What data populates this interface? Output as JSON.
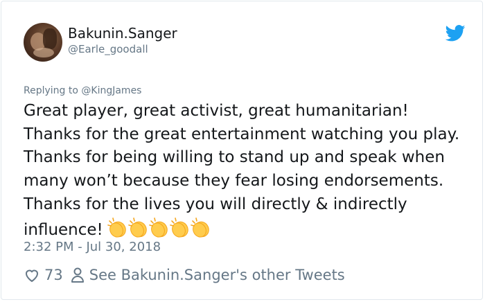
{
  "author": {
    "name": "Bakunin.Sanger",
    "handle": "@Earle_goodall"
  },
  "reply": {
    "prefix": "Replying to",
    "mention": "@KingJames"
  },
  "tweet": {
    "text": "Great player, great activist, great humanitarian! Thanks for the great entertainment watching you play. Thanks for being willing to stand up and speak when many won’t because they fear losing endorsements. Thanks for the lives you will directly & indirectly influence!",
    "emoji": "clapping-hands-emoji",
    "emoji_count": 5,
    "timestamp": "2:32 PM - Jul 30, 2018"
  },
  "actions": {
    "likes": "73",
    "other_tweets_label": "See Bakunin.Sanger's other Tweets"
  },
  "icons": {
    "brand": "twitter-bird-icon",
    "like": "heart-icon",
    "profile": "person-icon"
  },
  "colors": {
    "brand_blue": "#1da1f2",
    "text": "#14171a",
    "muted": "#657786",
    "border": "#e1e8ed",
    "clap_yellow": "#ffcc4d"
  }
}
